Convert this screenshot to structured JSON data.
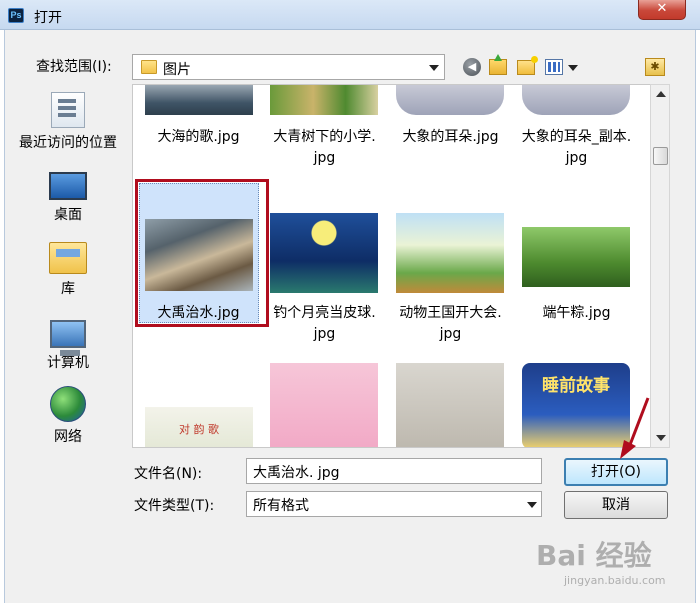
{
  "window": {
    "title": "打开",
    "app_icon_text": "Ps",
    "close_glyph": "✕"
  },
  "toolbar": {
    "look_in_label": "查找范围(I):",
    "look_in_value": "图片",
    "back_glyph": "◀",
    "desktop_glyph": "✱"
  },
  "places": [
    {
      "label": "最近访问的位置",
      "icon": "recent-places-icon"
    },
    {
      "label": "桌面",
      "icon": "desktop-icon"
    },
    {
      "label": "库",
      "icon": "library-icon"
    },
    {
      "label": "计算机",
      "icon": "computer-icon"
    },
    {
      "label": "网络",
      "icon": "network-icon"
    }
  ],
  "files": [
    {
      "name": "大海的歌.jpg",
      "lines": [
        "大海的歌.jpg"
      ]
    },
    {
      "name": "大青树下的小学.jpg",
      "lines": [
        "大青树下的小学.",
        "jpg"
      ]
    },
    {
      "name": "大象的耳朵.jpg",
      "lines": [
        "大象的耳朵.jpg"
      ]
    },
    {
      "name": "大象的耳朵_副本.jpg",
      "lines": [
        "大象的耳朵_副本.",
        "jpg"
      ]
    },
    {
      "name": "大禹治水.jpg",
      "lines": [
        "大禹治水.jpg"
      ],
      "selected": true
    },
    {
      "name": "钓个月亮当皮球.jpg",
      "lines": [
        "钓个月亮当皮球.",
        "jpg"
      ]
    },
    {
      "name": "动物王国开大会.jpg",
      "lines": [
        "动物王国开大会.",
        "jpg"
      ]
    },
    {
      "name": "端午粽.jpg",
      "lines": [
        "端午粽.jpg"
      ]
    },
    {
      "name": "对韵歌",
      "lines": [],
      "thumb_text": "对 韵 歌"
    },
    {
      "name": "",
      "lines": []
    },
    {
      "name": "",
      "lines": []
    },
    {
      "name": "睡前故事",
      "lines": [],
      "thumb_text": "睡前故事"
    }
  ],
  "file_name": {
    "label": "文件名(N):",
    "value": "大禹治水. jpg"
  },
  "file_type": {
    "label": "文件类型(T):",
    "value": "所有格式"
  },
  "buttons": {
    "open": "打开(O)",
    "cancel": "取消"
  },
  "watermark": {
    "main": "Bai 经验",
    "sub": "jingyan.baidu.com"
  },
  "colors": {
    "selection_border": "#b00d1e",
    "annotation_arrow": "#b00d1e"
  }
}
